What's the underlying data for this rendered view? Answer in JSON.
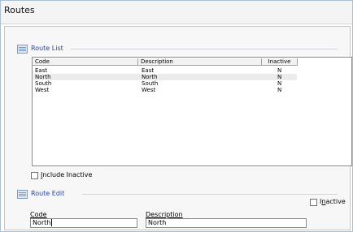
{
  "window": {
    "title": "Routes"
  },
  "route_list": {
    "title": "Route List",
    "columns": [
      "Code",
      "Description",
      "Inactive"
    ],
    "rows": [
      {
        "code": "East",
        "description": "East",
        "inactive": "N"
      },
      {
        "code": "North",
        "description": "North",
        "inactive": "N"
      },
      {
        "code": "South",
        "description": "South",
        "inactive": "N"
      },
      {
        "code": "West",
        "description": "West",
        "inactive": "N"
      }
    ],
    "include_inactive_underlined": "I",
    "include_inactive_rest": "nclude Inactive",
    "include_inactive_checked": false
  },
  "route_edit": {
    "title": "Route Edit",
    "inactive_pre": "I",
    "inactive_underlined": "n",
    "inactive_rest": "active",
    "inactive_checked": false,
    "code_label_underlined": "C",
    "code_label_rest": "ode",
    "code_value": "North",
    "description_label_underlined": "D",
    "description_label_rest": "escription",
    "description_value": "North"
  }
}
